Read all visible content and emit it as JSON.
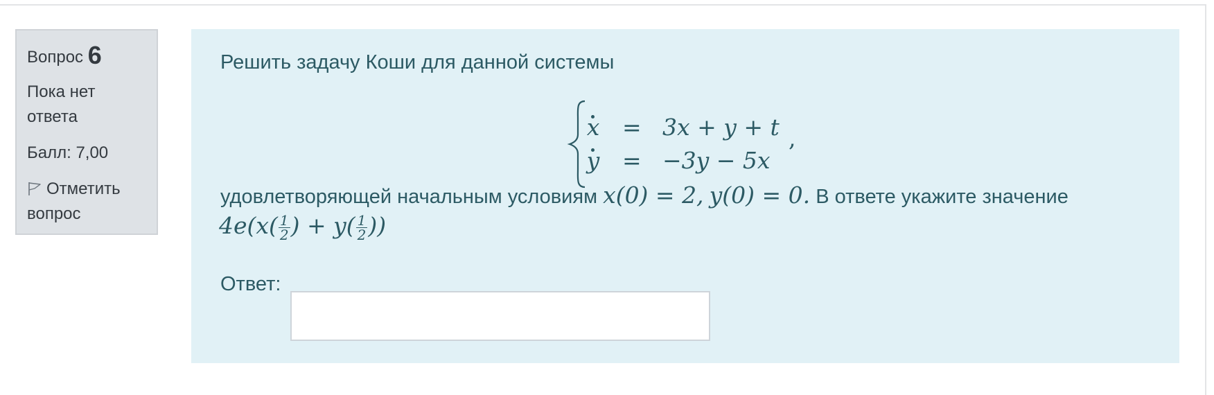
{
  "info": {
    "question_word": "Вопрос",
    "question_number": "6",
    "state": "Пока нет ответа",
    "grade": "Балл: 7,00",
    "flag_label": "Отметить вопрос",
    "flag_icon": "flag-icon"
  },
  "question": {
    "intro": "Решить задачу Коши для данной системы",
    "system": {
      "row1": {
        "lhs": "x",
        "eq": "=",
        "rhs": "3x + y + t"
      },
      "row2": {
        "lhs": "y",
        "eq": "=",
        "rhs": "−3y − 5x"
      },
      "trailing": ","
    },
    "condition_text": "удовлетворяющей начальным условиям",
    "condition_math_x": "x(0) = 2,",
    "condition_math_y": "y(0) = 0.",
    "condition_tail": "В ответе укажите значение",
    "expression": {
      "prefix": "4e(x(",
      "frac1": {
        "num": "1",
        "den": "2"
      },
      "middle": ") + y(",
      "frac2": {
        "num": "1",
        "den": "2"
      },
      "suffix": "))"
    }
  },
  "answer": {
    "label": "Ответ:",
    "value": ""
  },
  "colors": {
    "info_bg": "#dee2e6",
    "content_bg": "#e1f1f6",
    "text": "#2c5a64"
  }
}
